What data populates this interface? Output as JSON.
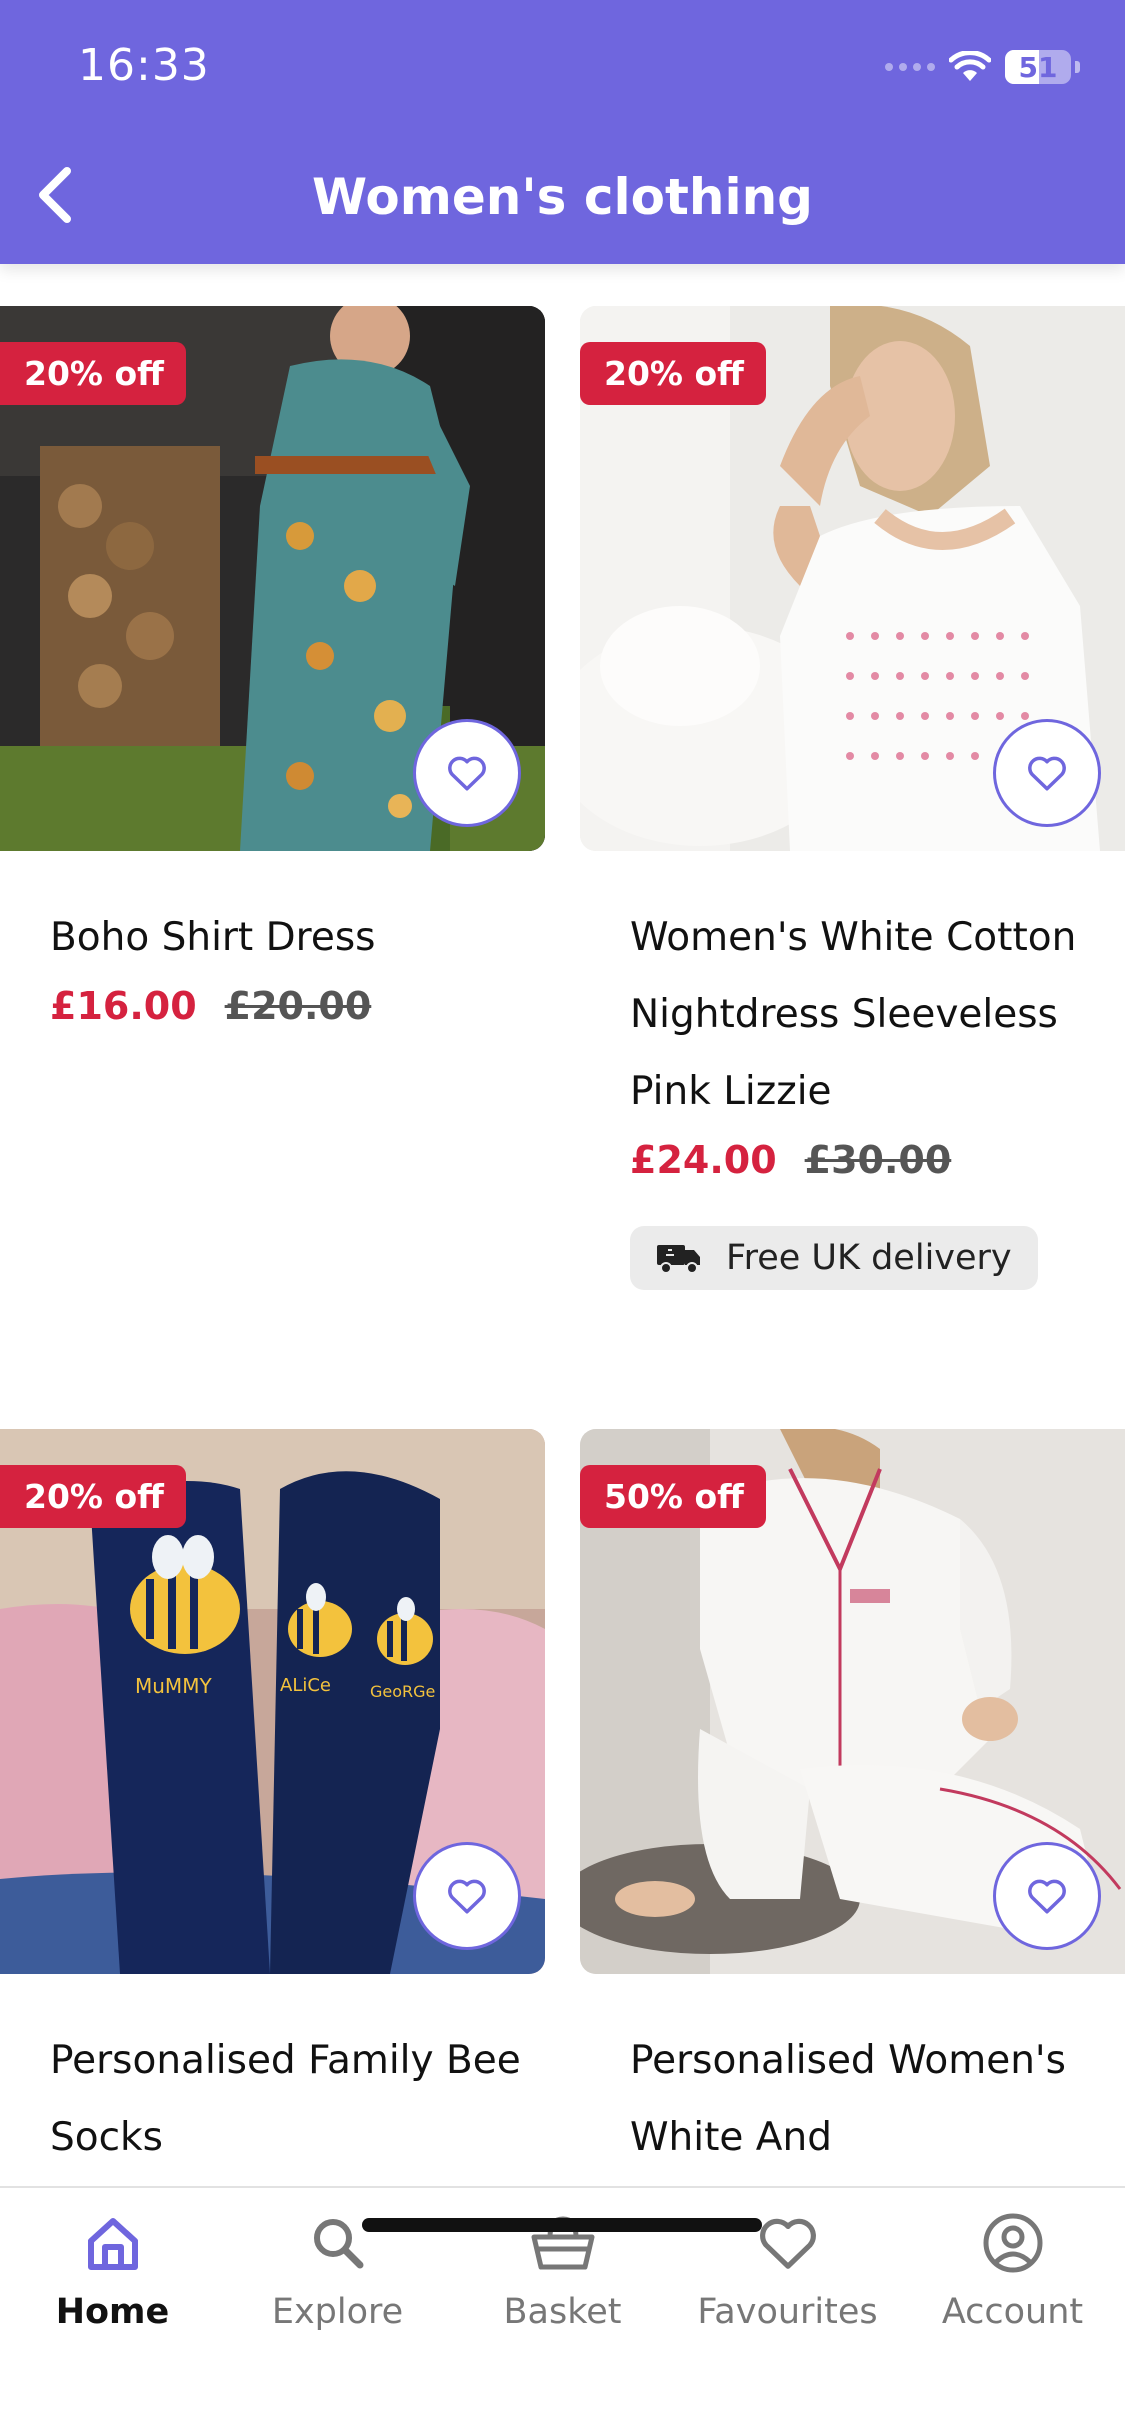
{
  "status_bar": {
    "time": "16:33",
    "battery": "51"
  },
  "header": {
    "title": "Women's clothing"
  },
  "products": [
    {
      "name": "Boho Shirt Dress",
      "discount": "20% off",
      "price_now": "£16.00",
      "price_was": "£20.00",
      "delivery": ""
    },
    {
      "name": "Women's White Cotton Nightdress Sleeveless Pink Lizzie",
      "discount": "20% off",
      "price_now": "£24.00",
      "price_was": "£30.00",
      "delivery": "Free UK delivery"
    },
    {
      "name": "Personalised Family Bee Socks",
      "discount": "20% off",
      "price_now": "",
      "price_was": "",
      "delivery": ""
    },
    {
      "name": "Personalised Women's White And",
      "discount": "50% off",
      "price_now": "",
      "price_was": "",
      "delivery": ""
    }
  ],
  "image_labels": {
    "sock_mummy": "MuMMY",
    "sock_alice": "ALiCe",
    "sock_george": "GeoRGe"
  },
  "nav": {
    "items": [
      {
        "label": "Home",
        "icon": "home-icon",
        "active": true
      },
      {
        "label": "Explore",
        "icon": "search-icon",
        "active": false
      },
      {
        "label": "Basket",
        "icon": "basket-icon",
        "active": false
      },
      {
        "label": "Favourites",
        "icon": "heart-icon",
        "active": false
      },
      {
        "label": "Account",
        "icon": "account-icon",
        "active": false
      }
    ]
  },
  "colors": {
    "brand": "#6f66de",
    "sale": "#d5223f"
  }
}
